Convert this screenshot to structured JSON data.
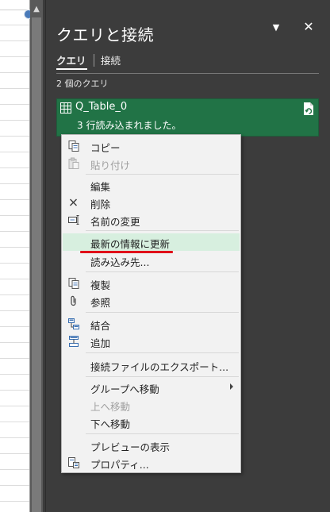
{
  "pane": {
    "title": "クエリと接続",
    "menu_icon": "dropdown-triangle-icon",
    "close_label": "✕",
    "tabs": [
      {
        "label": "クエリ",
        "active": true
      },
      {
        "label": "接続",
        "active": false
      }
    ],
    "query_count": "2 個のクエリ"
  },
  "query": {
    "name": "Q_Table_0",
    "status": "3 行読み込まれました。",
    "card_color": "#217346"
  },
  "context_menu": {
    "highlight_color": "#d7efdf",
    "annotation_color": "#e0101a",
    "items": [
      {
        "label": "コピー",
        "icon": "copy-icon",
        "enabled": true
      },
      {
        "label": "貼り付け",
        "icon": "paste-icon",
        "enabled": false
      },
      {
        "label": "編集",
        "icon": "",
        "enabled": true
      },
      {
        "label": "削除",
        "icon": "delete-x-icon",
        "enabled": true
      },
      {
        "label": "名前の変更",
        "icon": "rename-icon",
        "enabled": true
      },
      {
        "label": "最新の情報に更新",
        "icon": "",
        "enabled": true,
        "highlighted": true
      },
      {
        "label": "読み込み先...",
        "icon": "",
        "enabled": true
      },
      {
        "label": "複製",
        "icon": "duplicate-icon",
        "enabled": true
      },
      {
        "label": "参照",
        "icon": "reference-clip-icon",
        "enabled": true
      },
      {
        "label": "結合",
        "icon": "merge-icon",
        "enabled": true
      },
      {
        "label": "追加",
        "icon": "append-icon",
        "enabled": true
      },
      {
        "label": "接続ファイルのエクスポート...",
        "icon": "",
        "enabled": true
      },
      {
        "label": "グループへ移動",
        "icon": "",
        "enabled": true,
        "submenu": true
      },
      {
        "label": "上へ移動",
        "icon": "",
        "enabled": false
      },
      {
        "label": "下へ移動",
        "icon": "",
        "enabled": true
      },
      {
        "label": "プレビューの表示",
        "icon": "",
        "enabled": true
      },
      {
        "label": "プロパティ...",
        "icon": "properties-icon",
        "enabled": true
      }
    ]
  }
}
